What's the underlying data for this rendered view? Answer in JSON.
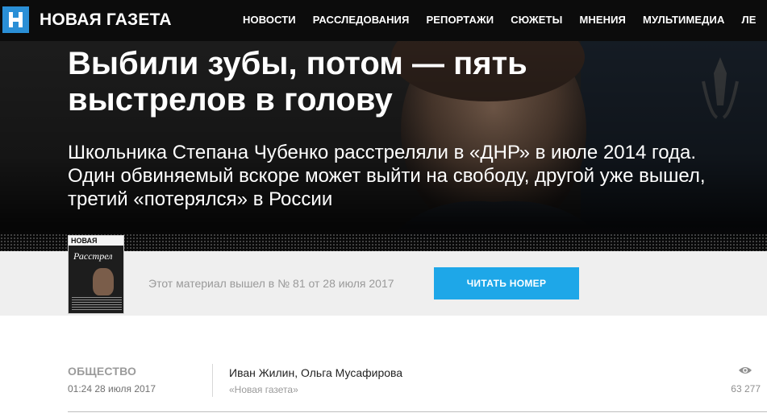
{
  "header": {
    "logo_text": "НОВАЯ ГАЗЕТА",
    "nav": [
      {
        "label": "НОВОСТИ"
      },
      {
        "label": "РАССЛЕДОВАНИЯ"
      },
      {
        "label": "РЕПОРТАЖИ"
      },
      {
        "label": "СЮЖЕТЫ"
      },
      {
        "label": "МНЕНИЯ"
      },
      {
        "label": "МУЛЬТИМЕДИА"
      },
      {
        "label": "ЛЕ"
      }
    ]
  },
  "article": {
    "title": "Выбили зубы, потом — пять выстрелов в голову",
    "lead": "Школьника Степана Чубенко расстреляли в «ДНР» в июле 2014 года. Один обвиняемый вскоре может выйти на свободу, другой уже вышел, третий «потерялся» в России"
  },
  "issue": {
    "cover_masthead": "НОВАЯ",
    "cover_title": "Расстрел",
    "text": "Этот материал вышел в № 81 от 28 июля 2017",
    "button_label": "ЧИТАТЬ НОМЕР"
  },
  "meta": {
    "rubric": "ОБЩЕСТВО",
    "date": "01:24 28 июля 2017",
    "authors": "Иван Жилин, Ольга Мусафирова",
    "source": "«Новая газета»",
    "views": "63 277",
    "views_icon": "eye-icon"
  },
  "colors": {
    "topbar": "#0c0c0c",
    "logo_blue": "#2a8fd6",
    "button_blue": "#1ea7e8",
    "strip_bg": "#efefef"
  }
}
